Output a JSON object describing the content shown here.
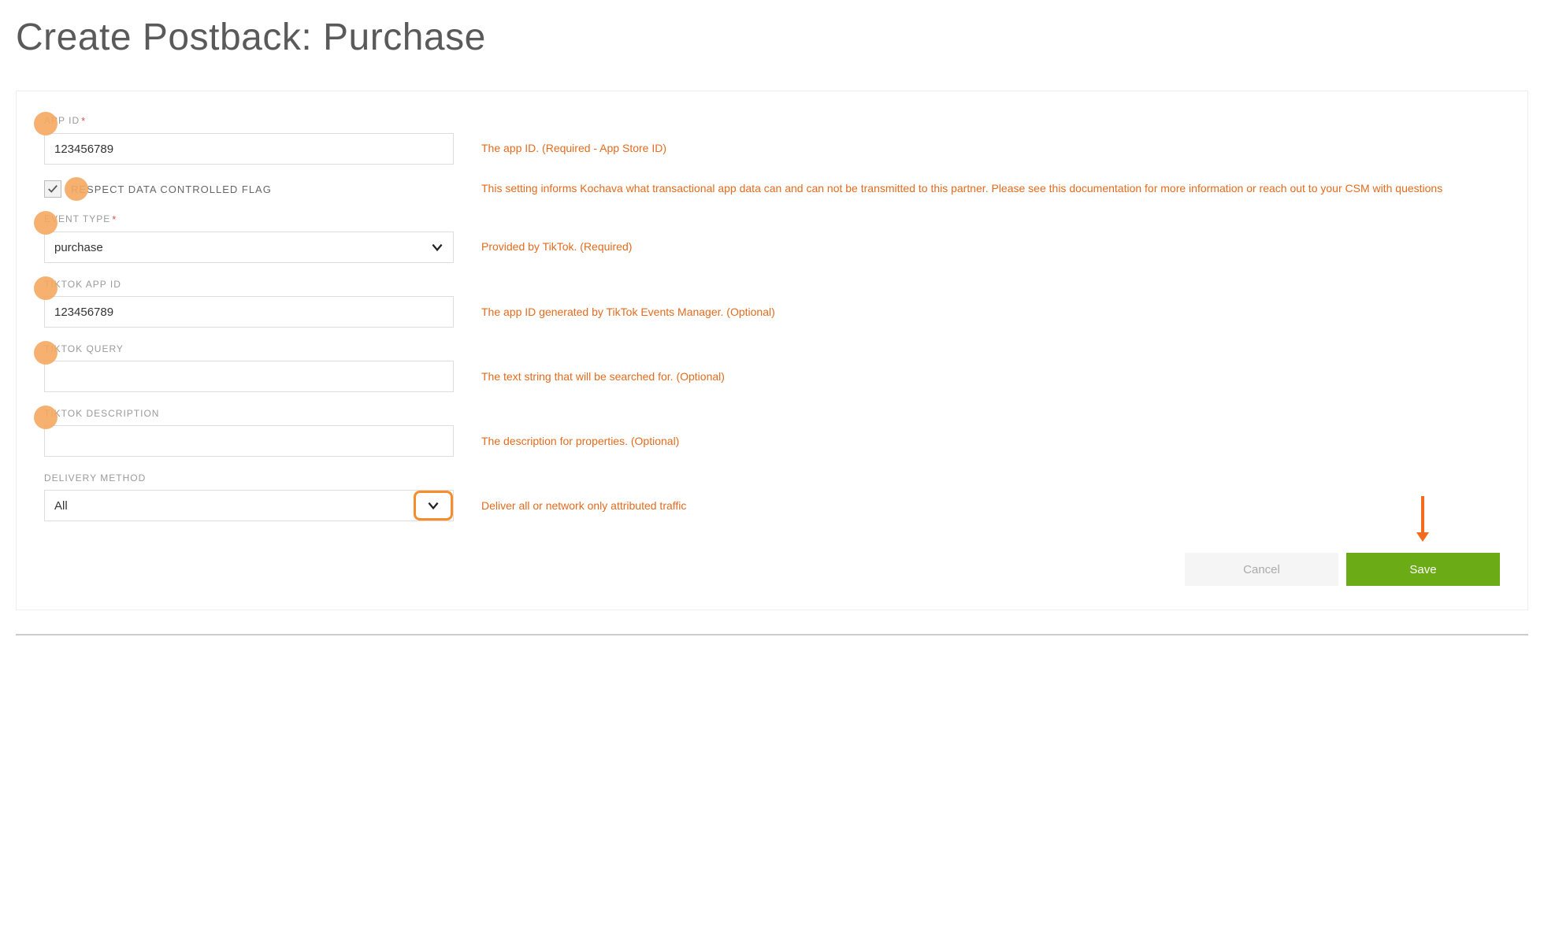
{
  "page": {
    "title": "Create Postback: Purchase"
  },
  "fields": {
    "app_id": {
      "label": "APP ID",
      "required": true,
      "value": "123456789",
      "help": "The app ID. (Required - App Store ID)"
    },
    "respect_flag": {
      "label": "RESPECT DATA CONTROLLED FLAG",
      "checked": true,
      "help": "This setting informs Kochava what transactional app data can and can not be transmitted to this partner. Please see this documentation for more information or reach out to your CSM with questions"
    },
    "event_type": {
      "label": "EVENT TYPE",
      "required": true,
      "value": "purchase",
      "help": "Provided by TikTok. (Required)"
    },
    "tiktok_app_id": {
      "label": "TIKTOK APP ID",
      "value": "123456789",
      "help": "The app ID generated by TikTok Events Manager. (Optional)"
    },
    "tiktok_query": {
      "label": "TIKTOK QUERY",
      "value": "",
      "help": "The text string that will be searched for. (Optional)"
    },
    "tiktok_description": {
      "label": "TIKTOK DESCRIPTION",
      "value": "",
      "help": "The description for properties. (Optional)"
    },
    "delivery_method": {
      "label": "DELIVERY METHOD",
      "value": "All",
      "help": "Deliver all or network only attributed traffic"
    }
  },
  "buttons": {
    "cancel": "Cancel",
    "save": "Save"
  }
}
